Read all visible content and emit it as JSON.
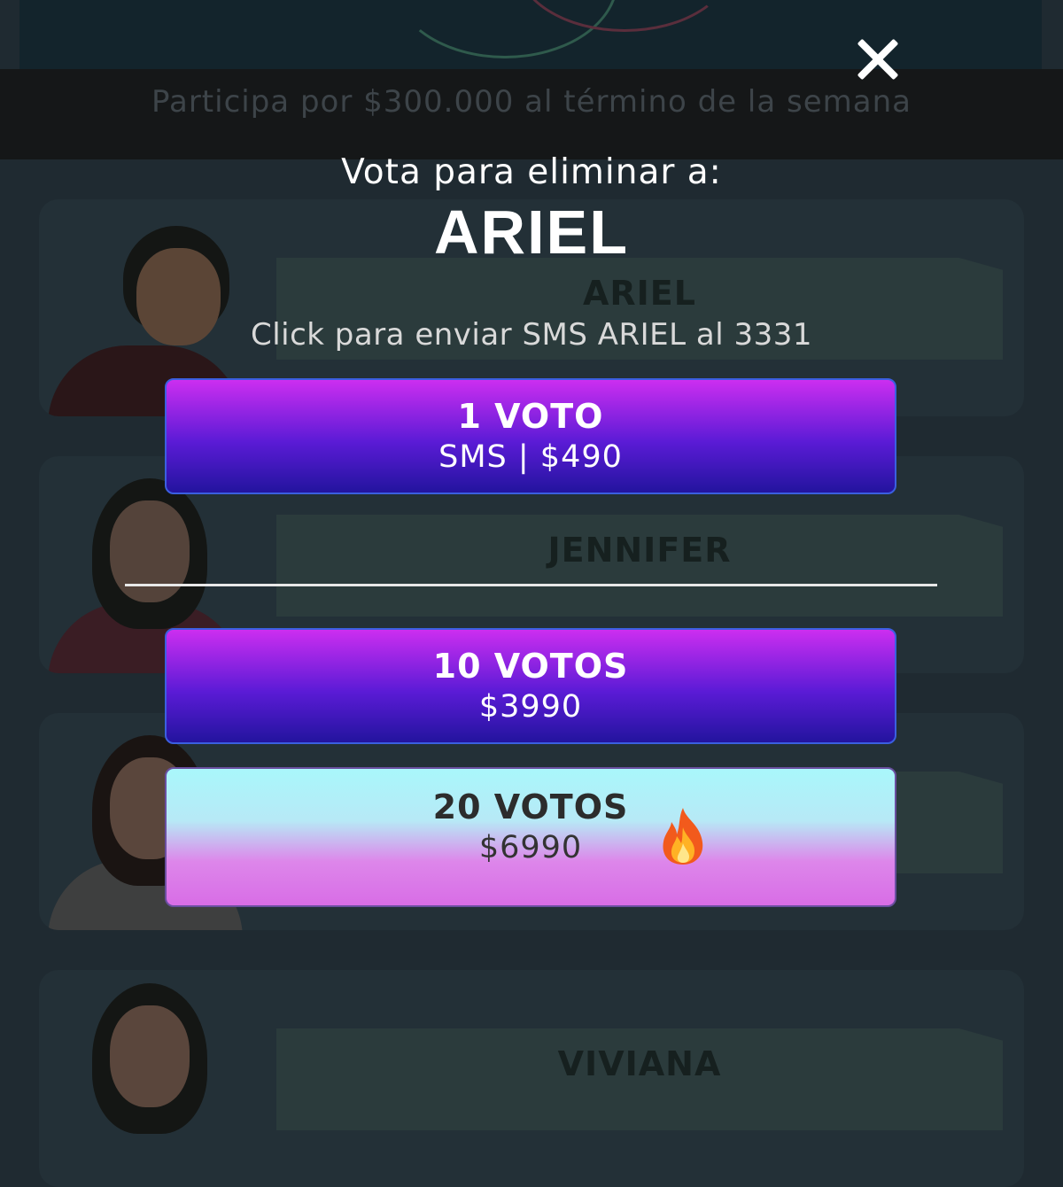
{
  "background": {
    "banner_text": "Participa por $300.000 al término de la semana",
    "cards": [
      {
        "name": "ARIEL"
      },
      {
        "name": "JENNIFER"
      },
      {
        "name": ""
      },
      {
        "name": "VIVIANA"
      }
    ]
  },
  "modal": {
    "prompt": "Vota para eliminar a:",
    "candidate": "ARIEL",
    "sms_hint": "Click para enviar SMS ARIEL al 3331",
    "options": [
      {
        "title": "1 VOTO",
        "price": "SMS | $490"
      },
      {
        "title": "10 VOTOS",
        "price": "$3990"
      },
      {
        "title": "20 VOTOS",
        "price": "$6990",
        "badge_icon": "fire-icon"
      }
    ]
  },
  "colors": {
    "primary_gradient_top": "#cc2ef0",
    "primary_gradient_bottom": "#23149e",
    "highlight_gradient_top": "#a9f7fb",
    "highlight_gradient_bottom": "#d86de6"
  }
}
